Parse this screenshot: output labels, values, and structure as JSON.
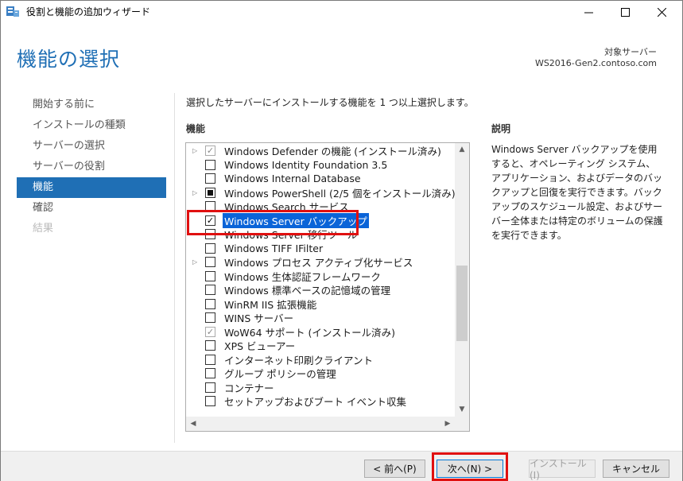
{
  "window": {
    "title": "役割と機能の追加ウィザード",
    "minimize_icon": "minimize-icon",
    "maximize_icon": "maximize-icon",
    "close_icon": "close-icon"
  },
  "header": {
    "page_title": "機能の選択",
    "destination_label": "対象サーバー",
    "destination_server": "WS2016-Gen2.contoso.com"
  },
  "nav": {
    "items": [
      {
        "label": "開始する前に",
        "state": "normal"
      },
      {
        "label": "インストールの種類",
        "state": "normal"
      },
      {
        "label": "サーバーの選択",
        "state": "normal"
      },
      {
        "label": "サーバーの役割",
        "state": "normal"
      },
      {
        "label": "機能",
        "state": "active"
      },
      {
        "label": "確認",
        "state": "normal"
      },
      {
        "label": "結果",
        "state": "disabled"
      }
    ]
  },
  "main": {
    "instruction": "選択したサーバーにインストールする機能を 1 つ以上選択します。",
    "features_header": "機能",
    "description_header": "説明",
    "description": "Windows Server バックアップを使用すると、オペレーティング システム、アプリケーション、およびデータのバックアップと回復を実行できます。バックアップのスケジュール設定、およびサーバー全体または特定のボリュームの保護を実行できます。"
  },
  "features": [
    {
      "label": "Windows Defender の機能 (インストール済み)",
      "expandable": true,
      "check": "gray"
    },
    {
      "label": "Windows Identity Foundation 3.5",
      "expandable": false,
      "check": "none"
    },
    {
      "label": "Windows Internal Database",
      "expandable": false,
      "check": "none"
    },
    {
      "label": "Windows PowerShell (2/5 個をインストール済み)",
      "expandable": true,
      "check": "partial"
    },
    {
      "label": "Windows Search サービス",
      "expandable": false,
      "check": "none"
    },
    {
      "label": "Windows Server バックアップ",
      "expandable": false,
      "check": "checked",
      "selected": true
    },
    {
      "label": "Windows Server 移行ツール",
      "expandable": false,
      "check": "none"
    },
    {
      "label": "Windows TIFF IFilter",
      "expandable": false,
      "check": "none"
    },
    {
      "label": "Windows プロセス アクティブ化サービス",
      "expandable": true,
      "check": "none"
    },
    {
      "label": "Windows 生体認証フレームワーク",
      "expandable": false,
      "check": "none"
    },
    {
      "label": "Windows 標準ベースの記憶域の管理",
      "expandable": false,
      "check": "none"
    },
    {
      "label": "WinRM IIS 拡張機能",
      "expandable": false,
      "check": "none"
    },
    {
      "label": "WINS サーバー",
      "expandable": false,
      "check": "none"
    },
    {
      "label": "WoW64 サポート (インストール済み)",
      "expandable": false,
      "check": "gray"
    },
    {
      "label": "XPS ビューアー",
      "expandable": false,
      "check": "none"
    },
    {
      "label": "インターネット印刷クライアント",
      "expandable": false,
      "check": "none"
    },
    {
      "label": "グループ ポリシーの管理",
      "expandable": false,
      "check": "none"
    },
    {
      "label": "コンテナー",
      "expandable": false,
      "check": "none"
    },
    {
      "label": "セットアップおよびブート イベント収集",
      "expandable": false,
      "check": "none"
    }
  ],
  "footer": {
    "prev_label": "< 前へ(P)",
    "next_label": "次へ(N) >",
    "install_label": "インストール(I)",
    "cancel_label": "キャンセル"
  },
  "colors": {
    "accent": "#1f6fb5",
    "selection": "#0a64d8",
    "highlight_box": "#e01010"
  }
}
